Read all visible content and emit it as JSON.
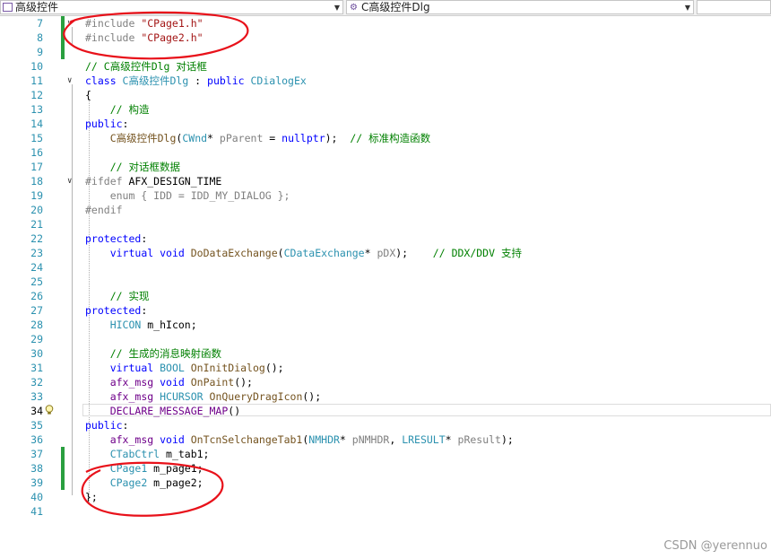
{
  "toolbar": {
    "scope_combo": "高级控件",
    "member_combo": "C高级控件Dlg"
  },
  "editor": {
    "current_line": "34",
    "lines": [
      {
        "n": "7",
        "tokens": [
          {
            "c": "pp",
            "t": "#include "
          },
          {
            "c": "s",
            "t": "\"CPage1.h\""
          }
        ]
      },
      {
        "n": "8",
        "tokens": [
          {
            "c": "pp",
            "t": "#include "
          },
          {
            "c": "s",
            "t": "\"CPage2.h\""
          }
        ]
      },
      {
        "n": "9",
        "tokens": []
      },
      {
        "n": "10",
        "tokens": [
          {
            "c": "c",
            "t": "// C高级控件Dlg 对话框"
          }
        ]
      },
      {
        "n": "11",
        "tokens": [
          {
            "c": "k",
            "t": "class "
          },
          {
            "c": "t",
            "t": "C高级控件Dlg"
          },
          {
            "c": "p",
            "t": " : "
          },
          {
            "c": "k",
            "t": "public "
          },
          {
            "c": "t",
            "t": "CDialogEx"
          }
        ]
      },
      {
        "n": "12",
        "tokens": [
          {
            "c": "p",
            "t": "{"
          }
        ]
      },
      {
        "n": "13",
        "tokens": [
          {
            "c": "p",
            "t": "    "
          },
          {
            "c": "c",
            "t": "// 构造"
          }
        ]
      },
      {
        "n": "14",
        "tokens": [
          {
            "c": "k",
            "t": "public"
          },
          {
            "c": "p",
            "t": ":"
          }
        ]
      },
      {
        "n": "15",
        "tokens": [
          {
            "c": "p",
            "t": "    "
          },
          {
            "c": "f",
            "t": "C高级控件Dlg"
          },
          {
            "c": "p",
            "t": "("
          },
          {
            "c": "t",
            "t": "CWnd"
          },
          {
            "c": "p",
            "t": "* "
          },
          {
            "c": "g",
            "t": "pParent"
          },
          {
            "c": "p",
            "t": " = "
          },
          {
            "c": "k",
            "t": "nullptr"
          },
          {
            "c": "p",
            "t": ");  "
          },
          {
            "c": "c",
            "t": "// 标准构造函数"
          }
        ]
      },
      {
        "n": "16",
        "tokens": []
      },
      {
        "n": "17",
        "tokens": [
          {
            "c": "p",
            "t": "    "
          },
          {
            "c": "c",
            "t": "// 对话框数据"
          }
        ]
      },
      {
        "n": "18",
        "tokens": [
          {
            "c": "pp",
            "t": "#ifdef "
          },
          {
            "c": "p",
            "t": "AFX_DESIGN_TIME"
          }
        ]
      },
      {
        "n": "19",
        "tokens": [
          {
            "c": "g",
            "t": "    enum { IDD = IDD_MY_DIALOG };"
          }
        ]
      },
      {
        "n": "20",
        "tokens": [
          {
            "c": "pp",
            "t": "#endif"
          }
        ]
      },
      {
        "n": "21",
        "tokens": []
      },
      {
        "n": "22",
        "tokens": [
          {
            "c": "k",
            "t": "protected"
          },
          {
            "c": "p",
            "t": ":"
          }
        ]
      },
      {
        "n": "23",
        "tokens": [
          {
            "c": "p",
            "t": "    "
          },
          {
            "c": "k",
            "t": "virtual void "
          },
          {
            "c": "f",
            "t": "DoDataExchange"
          },
          {
            "c": "p",
            "t": "("
          },
          {
            "c": "t",
            "t": "CDataExchange"
          },
          {
            "c": "p",
            "t": "* "
          },
          {
            "c": "g",
            "t": "pDX"
          },
          {
            "c": "p",
            "t": ");    "
          },
          {
            "c": "c",
            "t": "// DDX/DDV 支持"
          }
        ]
      },
      {
        "n": "24",
        "tokens": []
      },
      {
        "n": "25",
        "tokens": []
      },
      {
        "n": "26",
        "tokens": [
          {
            "c": "p",
            "t": "    "
          },
          {
            "c": "c",
            "t": "// 实现"
          }
        ]
      },
      {
        "n": "27",
        "tokens": [
          {
            "c": "k",
            "t": "protected"
          },
          {
            "c": "p",
            "t": ":"
          }
        ]
      },
      {
        "n": "28",
        "tokens": [
          {
            "c": "p",
            "t": "    "
          },
          {
            "c": "t",
            "t": "HICON"
          },
          {
            "c": "p",
            "t": " m_hIcon;"
          }
        ]
      },
      {
        "n": "29",
        "tokens": []
      },
      {
        "n": "30",
        "tokens": [
          {
            "c": "p",
            "t": "    "
          },
          {
            "c": "c",
            "t": "// 生成的消息映射函数"
          }
        ]
      },
      {
        "n": "31",
        "tokens": [
          {
            "c": "p",
            "t": "    "
          },
          {
            "c": "k",
            "t": "virtual "
          },
          {
            "c": "t",
            "t": "BOOL"
          },
          {
            "c": "p",
            "t": " "
          },
          {
            "c": "f",
            "t": "OnInitDialog"
          },
          {
            "c": "p",
            "t": "();"
          }
        ]
      },
      {
        "n": "32",
        "tokens": [
          {
            "c": "p",
            "t": "    "
          },
          {
            "c": "m",
            "t": "afx_msg"
          },
          {
            "c": "p",
            "t": " "
          },
          {
            "c": "k",
            "t": "void "
          },
          {
            "c": "f",
            "t": "OnPaint"
          },
          {
            "c": "p",
            "t": "();"
          }
        ]
      },
      {
        "n": "33",
        "tokens": [
          {
            "c": "p",
            "t": "    "
          },
          {
            "c": "m",
            "t": "afx_msg"
          },
          {
            "c": "p",
            "t": " "
          },
          {
            "c": "t",
            "t": "HCURSOR"
          },
          {
            "c": "p",
            "t": " "
          },
          {
            "c": "f",
            "t": "OnQueryDragIcon"
          },
          {
            "c": "p",
            "t": "();"
          }
        ]
      },
      {
        "n": "34",
        "tokens": [
          {
            "c": "p",
            "t": "    "
          },
          {
            "c": "m",
            "t": "DECLARE_MESSAGE_MAP"
          },
          {
            "c": "p",
            "t": "()"
          }
        ]
      },
      {
        "n": "35",
        "tokens": [
          {
            "c": "k",
            "t": "public"
          },
          {
            "c": "p",
            "t": ":"
          }
        ]
      },
      {
        "n": "36",
        "tokens": [
          {
            "c": "p",
            "t": "    "
          },
          {
            "c": "m",
            "t": "afx_msg"
          },
          {
            "c": "p",
            "t": " "
          },
          {
            "c": "k",
            "t": "void "
          },
          {
            "c": "f",
            "t": "OnTcnSelchangeTab1"
          },
          {
            "c": "p",
            "t": "("
          },
          {
            "c": "t",
            "t": "NMHDR"
          },
          {
            "c": "p",
            "t": "* "
          },
          {
            "c": "g",
            "t": "pNMHDR"
          },
          {
            "c": "p",
            "t": ", "
          },
          {
            "c": "t",
            "t": "LRESULT"
          },
          {
            "c": "p",
            "t": "* "
          },
          {
            "c": "g",
            "t": "pResult"
          },
          {
            "c": "p",
            "t": ");"
          }
        ]
      },
      {
        "n": "37",
        "tokens": [
          {
            "c": "p",
            "t": "    "
          },
          {
            "c": "t",
            "t": "CTabCtrl"
          },
          {
            "c": "p",
            "t": " m_tab1;"
          }
        ]
      },
      {
        "n": "38",
        "tokens": [
          {
            "c": "p",
            "t": "    "
          },
          {
            "c": "t",
            "t": "CPage1"
          },
          {
            "c": "p",
            "t": " m_page1;"
          }
        ]
      },
      {
        "n": "39",
        "tokens": [
          {
            "c": "p",
            "t": "    "
          },
          {
            "c": "t",
            "t": "CPage2"
          },
          {
            "c": "p",
            "t": " m_page2;"
          }
        ]
      },
      {
        "n": "40",
        "tokens": [
          {
            "c": "p",
            "t": "};"
          }
        ]
      },
      {
        "n": "41",
        "tokens": []
      }
    ]
  },
  "watermark": "CSDN @yerennuo",
  "colors": {
    "keyword": "#0000ff",
    "type": "#2b91af",
    "string": "#a31515",
    "comment": "#008000",
    "macro": "#6f008a",
    "annotation": "#e8111a"
  }
}
